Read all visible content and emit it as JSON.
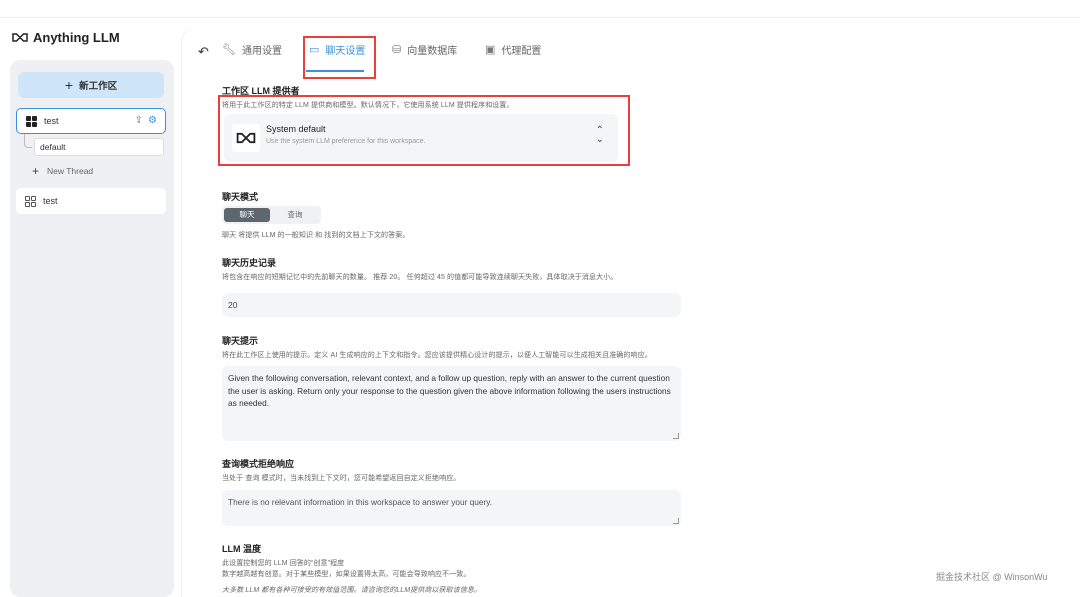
{
  "app": {
    "title": "Anything LLM"
  },
  "sidebar": {
    "new_workspace_label": "新工作区",
    "workspaces": [
      {
        "name": "test",
        "active": true,
        "threads": [
          {
            "name": "default"
          }
        ],
        "new_thread_label": "New Thread"
      },
      {
        "name": "test",
        "active": false
      }
    ]
  },
  "tabs": [
    {
      "label": "通用设置",
      "icon": "wrench-icon"
    },
    {
      "label": "聊天设置",
      "icon": "chat-icon",
      "active": true
    },
    {
      "label": "向量数据库",
      "icon": "database-icon"
    },
    {
      "label": "代理配置",
      "icon": "robot-icon"
    }
  ],
  "provider": {
    "title": "工作区 LLM 提供者",
    "desc": "将用于此工作区的特定 LLM 提供商和模型。默认情况下，它使用系统 LLM 提供程序和设置。",
    "selected_name": "System default",
    "selected_desc": "Use the system LLM preference for this workspace."
  },
  "chat_mode": {
    "title": "聊天模式",
    "options": [
      "聊天",
      "查询"
    ],
    "selected": "聊天",
    "desc": "聊天 将提供 LLM 的一般知识 和 找到的文档上下文的答案。"
  },
  "history": {
    "title": "聊天历史记录",
    "desc": "将包含在响应的短期记忆中的先前聊天的数量。 推荐 20。 任何超过 45 的值都可能导致连续聊天失败，具体取决于消息大小。",
    "value": "20"
  },
  "prompt": {
    "title": "聊天提示",
    "desc": "将在此工作区上使用的提示。定义 AI 生成响应的上下文和指令。您应该提供精心设计的提示，以便人工智能可以生成相关且准确的响应。",
    "value": "Given the following conversation, relevant context, and a follow up question, reply with an answer to the current question the user is asking. Return only your response to the question given the above information following the users instructions as needed."
  },
  "refusal": {
    "title": "查询模式拒绝响应",
    "desc": "当处于 查询 模式时，当未找到上下文时，您可能希望返回自定义拒绝响应。",
    "value": "There is no relevant information in this workspace to answer your query."
  },
  "temperature": {
    "title": "LLM 温度",
    "desc1": "此设置控制您的 LLM 回答的“创意”程度",
    "desc2": "数字越高越有创意。对于某些模型，如果设置得太高，可能会导致响应不一致。",
    "note": "大多数 LLM 都有各种可接受的有效值范围。请咨询您的LLM提供商以获取该信息。"
  },
  "watermark": "掘金技术社区 @ WinsonWu"
}
